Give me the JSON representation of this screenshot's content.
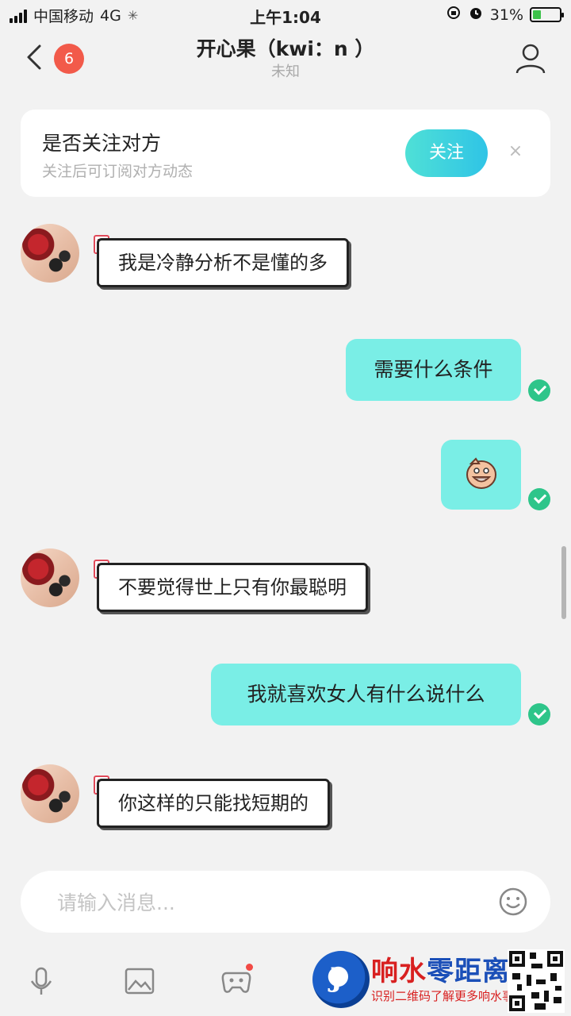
{
  "status_bar": {
    "carrier": "中国移动",
    "network": "4G",
    "time": "上午1:04",
    "battery_percent": "31%",
    "battery_level": 0.31
  },
  "header": {
    "unread_badge": "6",
    "title": "开心果（kwi：n ）",
    "subtitle": "未知"
  },
  "follow_card": {
    "title": "是否关注对方",
    "subtitle": "关注后可订阅对方动态",
    "button_label": "关注",
    "close_symbol": "×"
  },
  "messages": [
    {
      "direction": "in",
      "text": "我是冷静分析不是懂的多"
    },
    {
      "direction": "out",
      "text": "需要什么条件",
      "status": "read"
    },
    {
      "direction": "out",
      "type": "sticker",
      "icon": "smiling-face-sticker",
      "status": "read"
    },
    {
      "direction": "in",
      "text": "不要觉得世上只有你最聪明"
    },
    {
      "direction": "out",
      "text": "我就喜欢女人有什么说什么",
      "status": "read"
    },
    {
      "direction": "in",
      "text": "你这样的只能找短期的"
    }
  ],
  "composer": {
    "placeholder": "请输入消息..."
  },
  "toolbar": {
    "icons": [
      "microphone-icon",
      "image-icon",
      "gamepad-icon"
    ]
  },
  "watermark": {
    "logo_letter": "J",
    "title_red": "响水",
    "title_blue": "零距离",
    "subtitle": "识别二维码了解更多响水事"
  },
  "colors": {
    "accent": "#7aeee6",
    "follow_button": "#3fd2de",
    "badge": "#f25a4a",
    "read_check": "#2ec58a"
  }
}
